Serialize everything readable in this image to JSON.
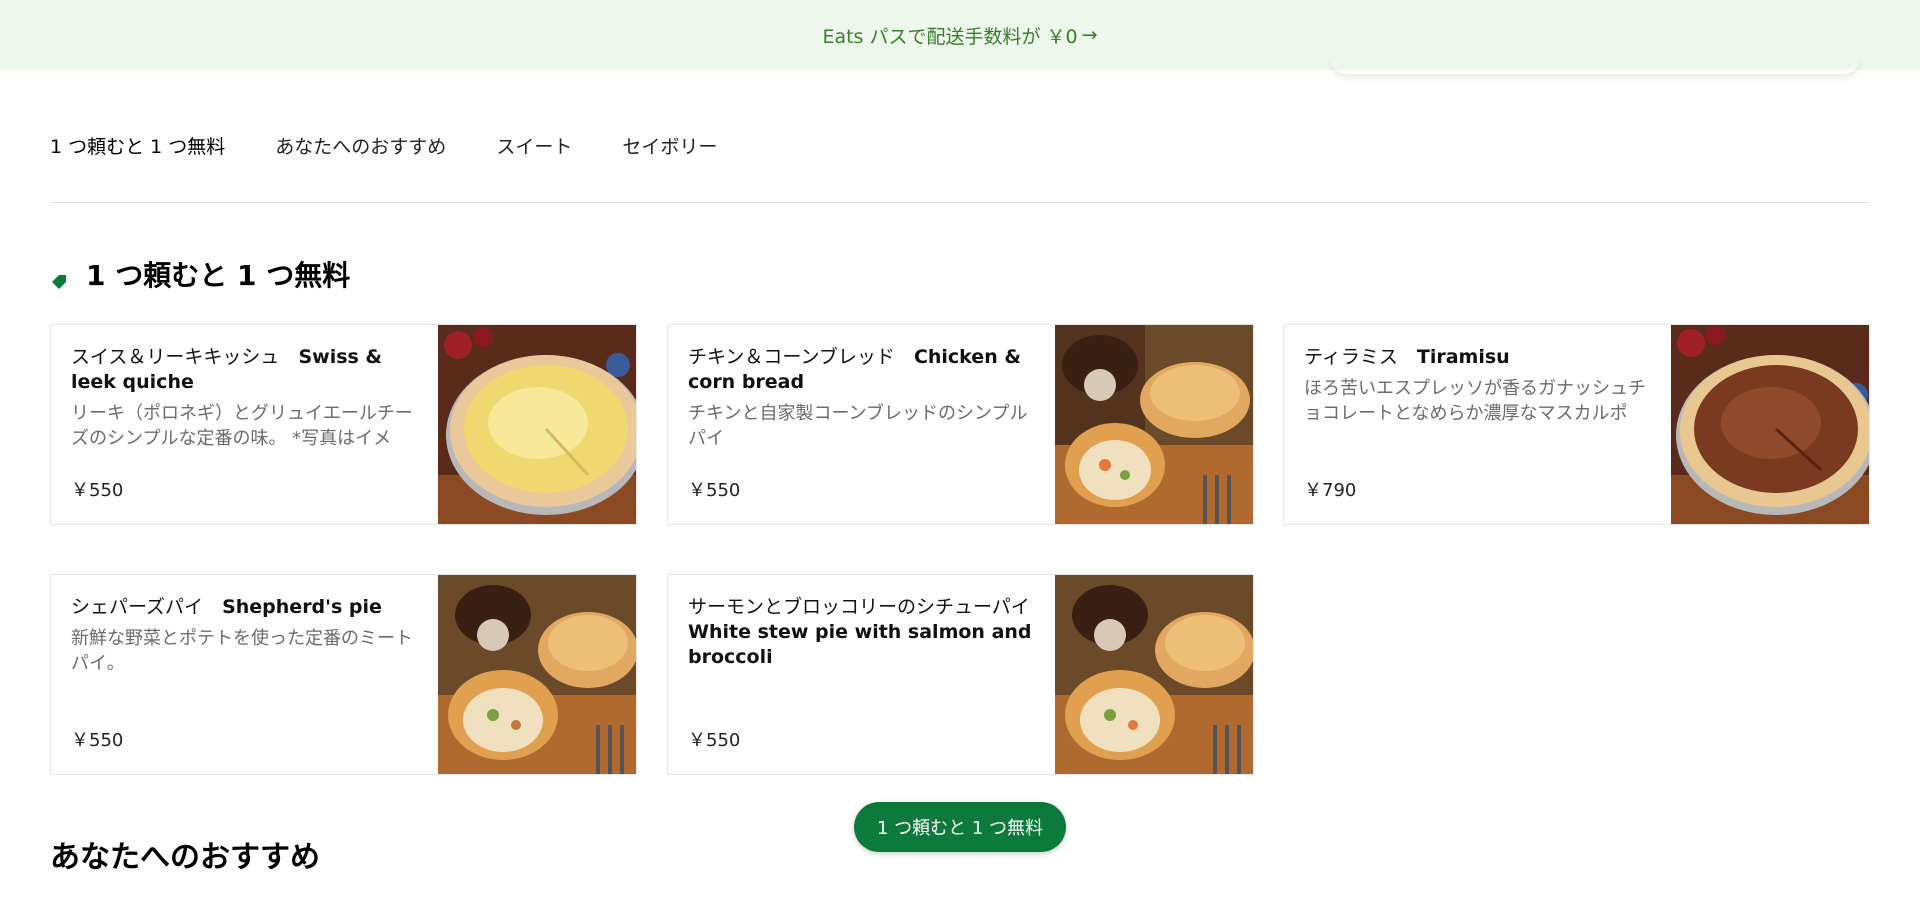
{
  "banner": {
    "text": "Eats パスで配送手数料が ￥0",
    "arrow": "→"
  },
  "tabs": [
    "1 つ頼むと 1 つ無料",
    "あなたへのおすすめ",
    "スイート",
    "セイボリー"
  ],
  "section": {
    "title": "1 つ頼むと 1 つ無料",
    "icon": "tag-icon",
    "accent": "#0b7a3b"
  },
  "items": [
    {
      "name_ja": "スイス＆リーキキッシュ",
      "name_en": "Swiss & leek quiche",
      "desc": "リーキ（ポロネギ）とグリュイエールチーズのシンプルな定番の味。 *写真はイメー...",
      "price": "￥550",
      "image": "quiche-image"
    },
    {
      "name_ja": "チキン＆コーンブレッド",
      "name_en": "Chicken & corn bread",
      "desc": "チキンと自家製コーンブレッドのシンプルパイ",
      "price": "￥550",
      "image": "pie-image"
    },
    {
      "name_ja": "ティラミス",
      "name_en": "Tiramisu",
      "desc": "ほろ苦いエスプレッソが香るガナッシュチョコレートとなめらか濃厚なマスカルポー...",
      "price": "￥790",
      "image": "tiramisu-image"
    },
    {
      "name_ja": "シェパーズパイ",
      "name_en": "Shepherd's pie",
      "desc": "新鮮な野菜とポテトを使った定番のミートパイ。",
      "price": "￥550",
      "image": "pie-image"
    },
    {
      "name_ja": "サーモンとブロッコリーのシチューパイ",
      "name_en": "White stew pie with salmon and broccoli",
      "desc": "",
      "price": "￥550",
      "image": "pie-image"
    }
  ],
  "floating_button": "1 つ頼むと 1 つ無料",
  "section2": {
    "title": "あなたへのおすすめ"
  },
  "colors": {
    "banner_bg": "#eef7ec",
    "banner_text": "#3a7d2c",
    "button_bg": "#0b7a3b"
  }
}
